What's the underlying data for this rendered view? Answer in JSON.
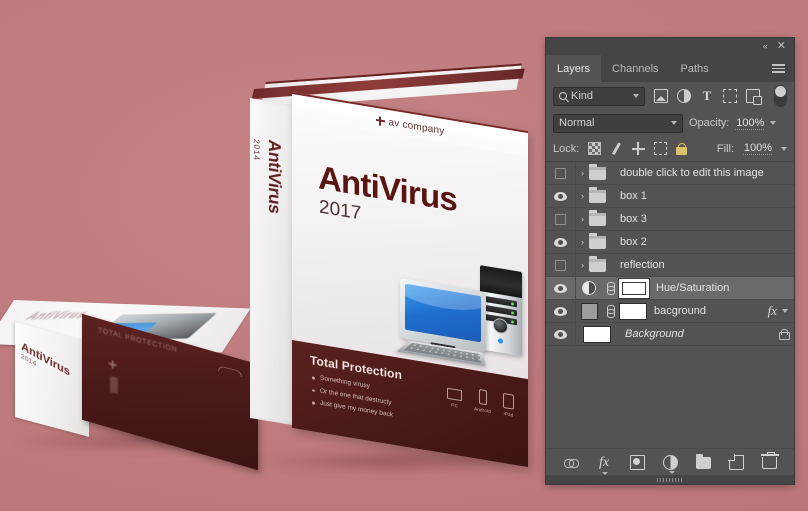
{
  "canvas": {
    "background_color": "#bf7b7e",
    "main_box": {
      "banner_text": "av company",
      "banner_icon": "plus-cross-icon",
      "title": "AntiVirus",
      "year": "2017",
      "spine_title": "AntiVirus",
      "spine_year": "2014",
      "illustration": "desktop-computer-illustration",
      "footer_heading": "Total Protection",
      "features": [
        "Something virusy",
        "Or the one that destructy",
        "Just give my money back"
      ],
      "devices": [
        {
          "icon": "monitor-icon",
          "label": "PC"
        },
        {
          "icon": "phone-icon",
          "label": "Android"
        },
        {
          "icon": "tablet-icon",
          "label": "iPad"
        }
      ]
    },
    "flat_box": {
      "spine_title": "AntiVirus",
      "spine_year": "2014",
      "front_text": "TOTAL PROTECTION"
    }
  },
  "panel": {
    "titlebar": {
      "collapse_label": "«",
      "close_label": "✕"
    },
    "tabs": [
      {
        "label": "Layers",
        "active": true
      },
      {
        "label": "Channels",
        "active": false
      },
      {
        "label": "Paths",
        "active": false
      }
    ],
    "menu_icon": "hamburger-menu-icon",
    "filter": {
      "search_icon": "magnifier-icon",
      "kind_label": "Kind",
      "icons": [
        "pixel-layer-filter-icon",
        "adjustment-layer-filter-icon",
        "type-layer-filter-icon",
        "shape-layer-filter-icon",
        "smart-object-filter-icon"
      ],
      "type_glyph": "T",
      "toggle_icon": "filter-toggle-switch"
    },
    "blend": {
      "mode": "Normal",
      "opacity_label": "Opacity:",
      "opacity_value": "100%"
    },
    "lock": {
      "label": "Lock:",
      "icons": [
        "lock-transparent-pixels-icon",
        "lock-image-pixels-icon",
        "lock-position-icon",
        "lock-artboard-nesting-icon",
        "lock-all-icon"
      ],
      "fill_label": "Fill:",
      "fill_value": "100%"
    },
    "layers": [
      {
        "name": "double click to edit this image",
        "visible": false,
        "type": "group",
        "selected": false,
        "locked": false,
        "fx": false
      },
      {
        "name": "box 1",
        "visible": true,
        "type": "group",
        "selected": false,
        "locked": false,
        "fx": false
      },
      {
        "name": "box 3",
        "visible": false,
        "type": "group",
        "selected": false,
        "locked": false,
        "fx": false
      },
      {
        "name": "box 2",
        "visible": true,
        "type": "group",
        "selected": false,
        "locked": false,
        "fx": false
      },
      {
        "name": "reflection",
        "visible": false,
        "type": "group",
        "selected": false,
        "locked": false,
        "fx": false
      },
      {
        "name": "Hue/Saturation",
        "visible": true,
        "type": "adjustment",
        "selected": true,
        "locked": false,
        "fx": false
      },
      {
        "name": "bacground",
        "visible": true,
        "type": "pixel",
        "selected": false,
        "locked": false,
        "fx": true,
        "fx_label": "fx"
      },
      {
        "name": "Background",
        "visible": true,
        "type": "background",
        "selected": false,
        "locked": true,
        "fx": false,
        "italic": true
      }
    ],
    "bottom_buttons": [
      {
        "icon": "link-layers-icon"
      },
      {
        "icon": "layer-style-fx-icon",
        "label": "fx"
      },
      {
        "icon": "add-layer-mask-icon"
      },
      {
        "icon": "new-adjustment-layer-icon"
      },
      {
        "icon": "new-group-icon"
      },
      {
        "icon": "new-layer-icon"
      },
      {
        "icon": "delete-layer-icon"
      }
    ]
  }
}
